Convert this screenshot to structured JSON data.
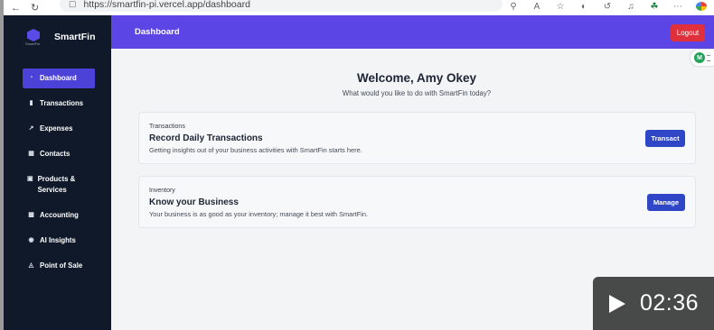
{
  "browser": {
    "url": "https://smartfin-pi.vercel.app/dashboard",
    "back_icon": "back-arrow-icon",
    "reload_icon": "reload-icon"
  },
  "brand": {
    "name": "SmartFin",
    "logo_caption": "SmartFin"
  },
  "sidebar": {
    "items": [
      {
        "label": "Dashboard",
        "icon": "gauge-icon",
        "active": true
      },
      {
        "label": "Transactions",
        "icon": "file-icon",
        "active": false
      },
      {
        "label": "Expenses",
        "icon": "chart-line-icon",
        "active": false
      },
      {
        "label": "Contacts",
        "icon": "contacts-icon",
        "active": false
      },
      {
        "label": "Products & Services",
        "icon": "box-icon",
        "active": false
      },
      {
        "label": "Accounting",
        "icon": "ledger-icon",
        "active": false
      },
      {
        "label": "AI Insights",
        "icon": "eye-icon",
        "active": false
      },
      {
        "label": "Point of Sale",
        "icon": "store-icon",
        "active": false
      }
    ]
  },
  "header": {
    "title": "Dashboard",
    "logout_label": "Logout"
  },
  "main": {
    "welcome": "Welcome, Amy Okey",
    "subtitle": "What would you like to do with SmartFin today?",
    "cards": [
      {
        "category": "Transactions",
        "heading": "Record Daily Transactions",
        "description": "Getting insights out of your business activities with SmartFin starts here.",
        "button": "Transact"
      },
      {
        "category": "Inventory",
        "heading": "Know your Business",
        "description": "Your business is as good as your inventory; manage it best with SmartFin.",
        "button": "Manage"
      }
    ]
  },
  "helper_badge": "M",
  "video": {
    "time": "02:36"
  },
  "colors": {
    "sidebar_bg": "#101929",
    "header_bg": "#5b46e5",
    "active_item": "#4d42d8",
    "button_blue": "#2f47c7",
    "logout_red": "#e0303b"
  }
}
